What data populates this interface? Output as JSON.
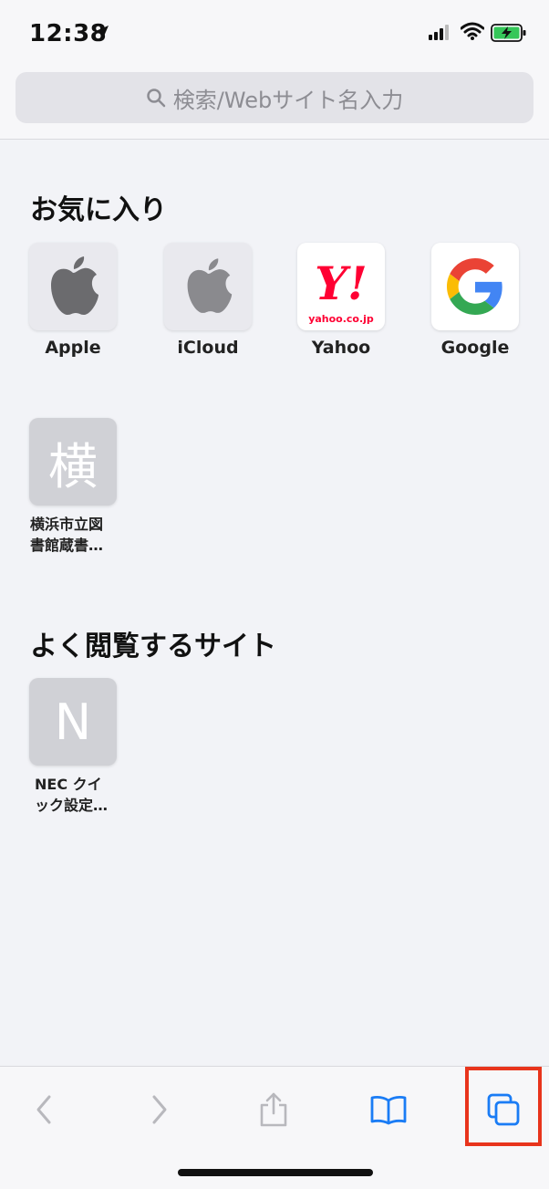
{
  "status_bar": {
    "time": "12:38"
  },
  "address_bar": {
    "placeholder": "検索/Webサイト名入力"
  },
  "favorites": {
    "title": "お気に入り",
    "items": [
      {
        "label": "Apple",
        "icon": "apple-logo-icon"
      },
      {
        "label": "iCloud",
        "icon": "apple-logo-icon"
      },
      {
        "label": "Yahoo",
        "icon": "yahoo-logo-icon",
        "logo_text": "Y!",
        "logo_sub": "yahoo.co.jp"
      },
      {
        "label": "Google",
        "icon": "google-logo-icon"
      },
      {
        "label": "横浜市立図書館蔵書…",
        "label_line1": "横浜市立図",
        "label_line2": "書館蔵書…",
        "letter": "横"
      }
    ]
  },
  "frequently_visited": {
    "title": "よく閲覧するサイト",
    "items": [
      {
        "label_line1": "NEC クイ",
        "label_line2": "ック設定…",
        "letter": "N"
      }
    ]
  },
  "toolbar": {
    "buttons": [
      "back-icon",
      "forward-icon",
      "share-icon",
      "bookmarks-icon",
      "tabs-icon"
    ],
    "accent_color": "#1a7cf5",
    "disabled_color": "#b8b8bd",
    "highlight_color": "#e8341c"
  }
}
